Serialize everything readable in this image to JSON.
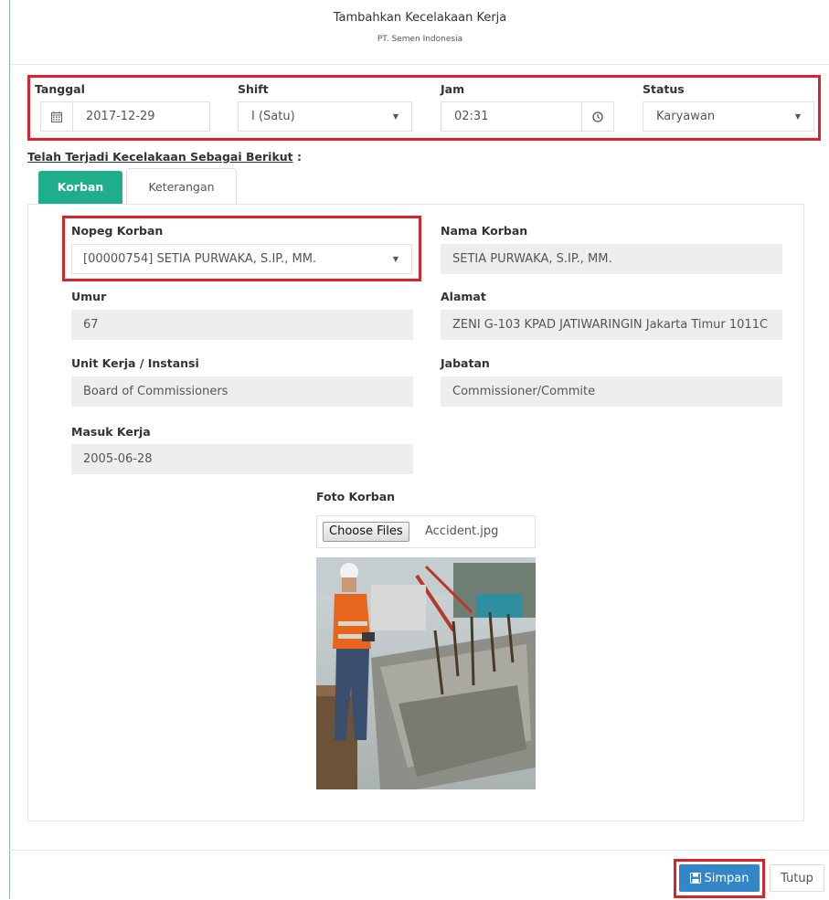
{
  "header": {
    "title": "Tambahkan Kecelakaan Kerja",
    "subtitle": "PT. Semen Indonesia"
  },
  "top_row": {
    "tanggal_label": "Tanggal",
    "tanggal_value": "2017-12-29",
    "shift_label": "Shift",
    "shift_value": "I (Satu)",
    "jam_label": "Jam",
    "jam_value": "02:31",
    "status_label": "Status",
    "status_value": "Karyawan"
  },
  "section": {
    "title": "Telah Terjadi Kecelakaan Sebagai Berikut",
    "colon": " :"
  },
  "tabs": [
    {
      "label": "Korban",
      "active": true
    },
    {
      "label": "Keterangan",
      "active": false
    }
  ],
  "korban": {
    "nopeg_label": "Nopeg Korban",
    "nopeg_value": "[00000754] SETIA PURWAKA, S.IP., MM.",
    "nama_label": "Nama Korban",
    "nama_value": "SETIA PURWAKA, S.IP., MM.",
    "umur_label": "Umur",
    "umur_value": "67",
    "alamat_label": "Alamat",
    "alamat_value": "ZENI G-103 KPAD JATIWARINGIN Jakarta Timur 1011C",
    "unit_label": "Unit Kerja / Instansi",
    "unit_value": "Board of Commissioners",
    "jabatan_label": "Jabatan",
    "jabatan_value": "Commissioner/Commite",
    "masuk_label": "Masuk Kerja",
    "masuk_value": "2005-06-28",
    "foto_label": "Foto Korban",
    "choose_files_label": "Choose Files",
    "file_name": "Accident.jpg"
  },
  "footer": {
    "save_label": "Simpan",
    "close_label": "Tutup"
  },
  "colors": {
    "highlight": "#d9232e",
    "tab_active": "#1fae8b",
    "primary_button": "#3387c8"
  }
}
